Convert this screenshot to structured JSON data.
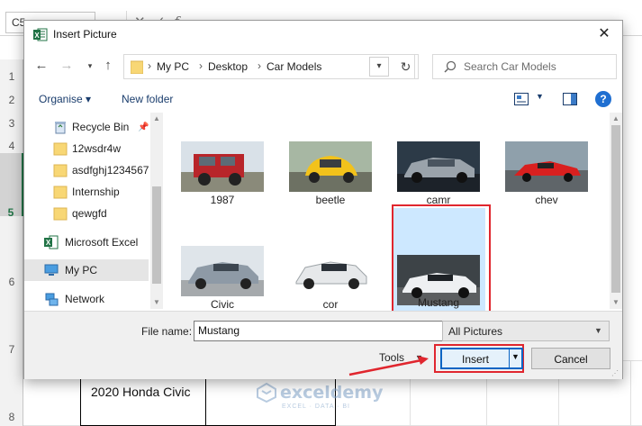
{
  "excel": {
    "name_box": "C5",
    "formula_fx": "f",
    "row_numbers": [
      "1",
      "2",
      "3",
      "4",
      "5",
      "6",
      "7",
      "8"
    ],
    "cell_text": "2020 Honda Civic",
    "watermark_name": "exceldemy",
    "watermark_tag": "EXCEL · DATA · BI"
  },
  "dialog": {
    "title": "Insert Picture",
    "close_glyph": "✕",
    "address": {
      "crumbs": [
        "My PC",
        "Desktop",
        "Car Models"
      ]
    },
    "search": {
      "placeholder": "Search Car Models"
    },
    "toolbar": {
      "organise_label": "Organise ▾",
      "new_folder_label": "New folder",
      "help_glyph": "?"
    },
    "nav_items": [
      {
        "label": "Recycle Bin",
        "icon": "recycle-bin-icon"
      },
      {
        "label": "12wsdr4w",
        "icon": "folder-icon"
      },
      {
        "label": "asdfghj1234567",
        "icon": "folder-icon"
      },
      {
        "label": "Internship",
        "icon": "folder-icon"
      },
      {
        "label": "qewgfd",
        "icon": "folder-icon"
      },
      {
        "label": "Microsoft Excel",
        "icon": "excel-icon"
      },
      {
        "label": "My PC",
        "icon": "pc-icon"
      },
      {
        "label": "Network",
        "icon": "network-icon"
      }
    ],
    "files": [
      {
        "name": "1987"
      },
      {
        "name": "beetle"
      },
      {
        "name": "camr"
      },
      {
        "name": "chev"
      },
      {
        "name": "Civic"
      },
      {
        "name": "cor"
      },
      {
        "name": "Mustang"
      }
    ],
    "bottom": {
      "file_name_label": "File name:",
      "file_name_value": "Mustang",
      "file_type": "All Pictures",
      "tools_label": "Tools",
      "insert_label": "Insert",
      "cancel_label": "Cancel"
    }
  },
  "colors": {
    "highlight_red": "#e0262e",
    "selection_blue": "#cde8ff",
    "excel_green": "#217346",
    "accent_blue": "#0a64c4"
  }
}
